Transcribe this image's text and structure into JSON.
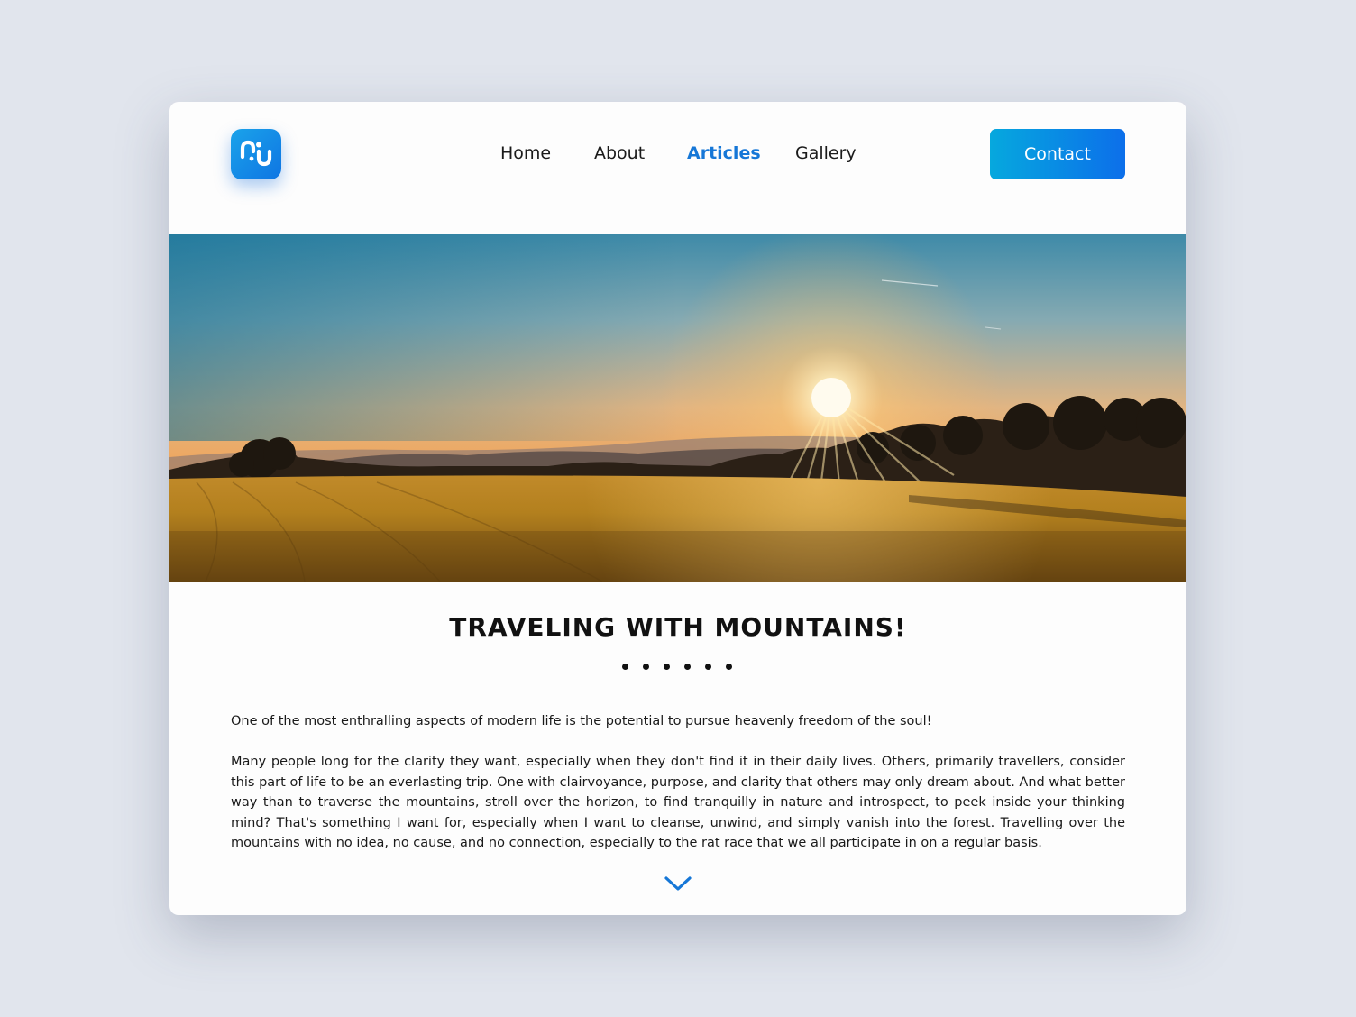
{
  "brand": {
    "logo_icon": "stylized-waves-logo-icon",
    "accent_color": "#1677d7",
    "button_gradient": [
      "#06a8de",
      "#0c6fea"
    ]
  },
  "nav": {
    "items": [
      {
        "label": "Home",
        "active": false
      },
      {
        "label": "About",
        "active": false
      },
      {
        "label": "Articles",
        "active": true
      },
      {
        "label": "Gallery",
        "active": false
      }
    ],
    "contact_label": "Contact"
  },
  "article": {
    "title": "TRAVELING WITH MOUNTAINS!",
    "divider_dots": 6,
    "intro": "One of the most enthralling aspects of modern life is the potential to pursue heavenly freedom of the soul!",
    "paragraph": "Many people long for the clarity they want, especially when they don't find it in their daily lives. Others, primarily travellers, consider this part of life to be an everlasting trip. One with clairvoyance, purpose, and clarity that others may only dream about. And what better way than to traverse the mountains, stroll over the horizon, to find tranquilly in nature and introspect, to peek inside your thinking mind? That's something I want for, especially when I want to cleanse, unwind, and simply vanish into the forest. Travelling over the mountains with no idea, no cause, and no connection, especially to the rat race that we all participate in on a regular basis.",
    "scroll_icon": "chevron-down-icon"
  },
  "hero": {
    "image_subject": "sunset over golden wheat field with hills and trees"
  }
}
